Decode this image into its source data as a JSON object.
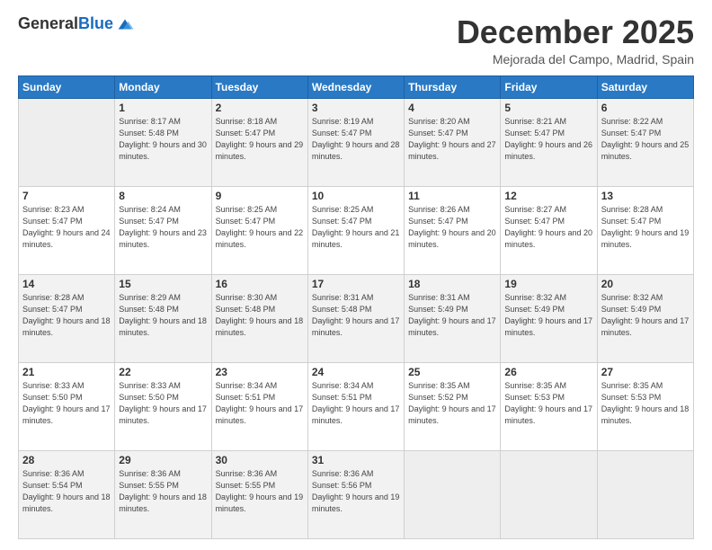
{
  "logo": {
    "general": "General",
    "blue": "Blue"
  },
  "header": {
    "month": "December 2025",
    "location": "Mejorada del Campo, Madrid, Spain"
  },
  "weekdays": [
    "Sunday",
    "Monday",
    "Tuesday",
    "Wednesday",
    "Thursday",
    "Friday",
    "Saturday"
  ],
  "weeks": [
    [
      {
        "day": "",
        "sunrise": "",
        "sunset": "",
        "daylight": ""
      },
      {
        "day": "1",
        "sunrise": "Sunrise: 8:17 AM",
        "sunset": "Sunset: 5:48 PM",
        "daylight": "Daylight: 9 hours and 30 minutes."
      },
      {
        "day": "2",
        "sunrise": "Sunrise: 8:18 AM",
        "sunset": "Sunset: 5:47 PM",
        "daylight": "Daylight: 9 hours and 29 minutes."
      },
      {
        "day": "3",
        "sunrise": "Sunrise: 8:19 AM",
        "sunset": "Sunset: 5:47 PM",
        "daylight": "Daylight: 9 hours and 28 minutes."
      },
      {
        "day": "4",
        "sunrise": "Sunrise: 8:20 AM",
        "sunset": "Sunset: 5:47 PM",
        "daylight": "Daylight: 9 hours and 27 minutes."
      },
      {
        "day": "5",
        "sunrise": "Sunrise: 8:21 AM",
        "sunset": "Sunset: 5:47 PM",
        "daylight": "Daylight: 9 hours and 26 minutes."
      },
      {
        "day": "6",
        "sunrise": "Sunrise: 8:22 AM",
        "sunset": "Sunset: 5:47 PM",
        "daylight": "Daylight: 9 hours and 25 minutes."
      }
    ],
    [
      {
        "day": "7",
        "sunrise": "Sunrise: 8:23 AM",
        "sunset": "Sunset: 5:47 PM",
        "daylight": "Daylight: 9 hours and 24 minutes."
      },
      {
        "day": "8",
        "sunrise": "Sunrise: 8:24 AM",
        "sunset": "Sunset: 5:47 PM",
        "daylight": "Daylight: 9 hours and 23 minutes."
      },
      {
        "day": "9",
        "sunrise": "Sunrise: 8:25 AM",
        "sunset": "Sunset: 5:47 PM",
        "daylight": "Daylight: 9 hours and 22 minutes."
      },
      {
        "day": "10",
        "sunrise": "Sunrise: 8:25 AM",
        "sunset": "Sunset: 5:47 PM",
        "daylight": "Daylight: 9 hours and 21 minutes."
      },
      {
        "day": "11",
        "sunrise": "Sunrise: 8:26 AM",
        "sunset": "Sunset: 5:47 PM",
        "daylight": "Daylight: 9 hours and 20 minutes."
      },
      {
        "day": "12",
        "sunrise": "Sunrise: 8:27 AM",
        "sunset": "Sunset: 5:47 PM",
        "daylight": "Daylight: 9 hours and 20 minutes."
      },
      {
        "day": "13",
        "sunrise": "Sunrise: 8:28 AM",
        "sunset": "Sunset: 5:47 PM",
        "daylight": "Daylight: 9 hours and 19 minutes."
      }
    ],
    [
      {
        "day": "14",
        "sunrise": "Sunrise: 8:28 AM",
        "sunset": "Sunset: 5:47 PM",
        "daylight": "Daylight: 9 hours and 18 minutes."
      },
      {
        "day": "15",
        "sunrise": "Sunrise: 8:29 AM",
        "sunset": "Sunset: 5:48 PM",
        "daylight": "Daylight: 9 hours and 18 minutes."
      },
      {
        "day": "16",
        "sunrise": "Sunrise: 8:30 AM",
        "sunset": "Sunset: 5:48 PM",
        "daylight": "Daylight: 9 hours and 18 minutes."
      },
      {
        "day": "17",
        "sunrise": "Sunrise: 8:31 AM",
        "sunset": "Sunset: 5:48 PM",
        "daylight": "Daylight: 9 hours and 17 minutes."
      },
      {
        "day": "18",
        "sunrise": "Sunrise: 8:31 AM",
        "sunset": "Sunset: 5:49 PM",
        "daylight": "Daylight: 9 hours and 17 minutes."
      },
      {
        "day": "19",
        "sunrise": "Sunrise: 8:32 AM",
        "sunset": "Sunset: 5:49 PM",
        "daylight": "Daylight: 9 hours and 17 minutes."
      },
      {
        "day": "20",
        "sunrise": "Sunrise: 8:32 AM",
        "sunset": "Sunset: 5:49 PM",
        "daylight": "Daylight: 9 hours and 17 minutes."
      }
    ],
    [
      {
        "day": "21",
        "sunrise": "Sunrise: 8:33 AM",
        "sunset": "Sunset: 5:50 PM",
        "daylight": "Daylight: 9 hours and 17 minutes."
      },
      {
        "day": "22",
        "sunrise": "Sunrise: 8:33 AM",
        "sunset": "Sunset: 5:50 PM",
        "daylight": "Daylight: 9 hours and 17 minutes."
      },
      {
        "day": "23",
        "sunrise": "Sunrise: 8:34 AM",
        "sunset": "Sunset: 5:51 PM",
        "daylight": "Daylight: 9 hours and 17 minutes."
      },
      {
        "day": "24",
        "sunrise": "Sunrise: 8:34 AM",
        "sunset": "Sunset: 5:51 PM",
        "daylight": "Daylight: 9 hours and 17 minutes."
      },
      {
        "day": "25",
        "sunrise": "Sunrise: 8:35 AM",
        "sunset": "Sunset: 5:52 PM",
        "daylight": "Daylight: 9 hours and 17 minutes."
      },
      {
        "day": "26",
        "sunrise": "Sunrise: 8:35 AM",
        "sunset": "Sunset: 5:53 PM",
        "daylight": "Daylight: 9 hours and 17 minutes."
      },
      {
        "day": "27",
        "sunrise": "Sunrise: 8:35 AM",
        "sunset": "Sunset: 5:53 PM",
        "daylight": "Daylight: 9 hours and 18 minutes."
      }
    ],
    [
      {
        "day": "28",
        "sunrise": "Sunrise: 8:36 AM",
        "sunset": "Sunset: 5:54 PM",
        "daylight": "Daylight: 9 hours and 18 minutes."
      },
      {
        "day": "29",
        "sunrise": "Sunrise: 8:36 AM",
        "sunset": "Sunset: 5:55 PM",
        "daylight": "Daylight: 9 hours and 18 minutes."
      },
      {
        "day": "30",
        "sunrise": "Sunrise: 8:36 AM",
        "sunset": "Sunset: 5:55 PM",
        "daylight": "Daylight: 9 hours and 19 minutes."
      },
      {
        "day": "31",
        "sunrise": "Sunrise: 8:36 AM",
        "sunset": "Sunset: 5:56 PM",
        "daylight": "Daylight: 9 hours and 19 minutes."
      },
      {
        "day": "",
        "sunrise": "",
        "sunset": "",
        "daylight": ""
      },
      {
        "day": "",
        "sunrise": "",
        "sunset": "",
        "daylight": ""
      },
      {
        "day": "",
        "sunrise": "",
        "sunset": "",
        "daylight": ""
      }
    ]
  ]
}
